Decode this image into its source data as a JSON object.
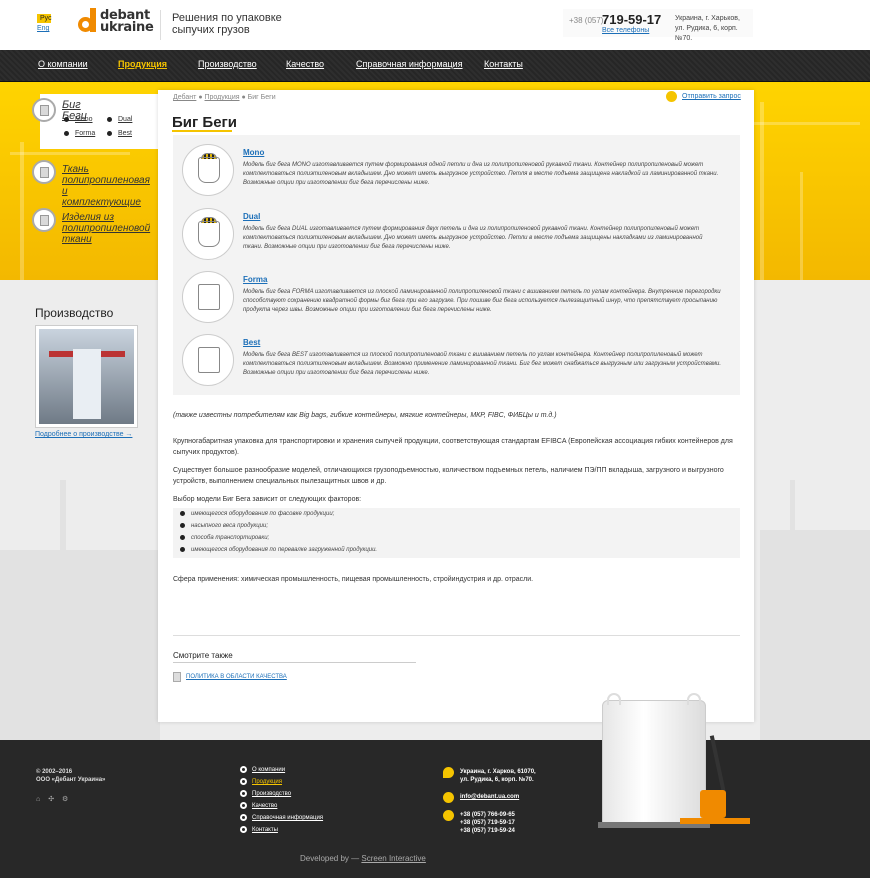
{
  "header": {
    "lang_ru": "Рус",
    "lang_en": "Eng",
    "logo_line1": "debant",
    "logo_line2": "ukraine",
    "tagline": "Решения по упаковке сыпучих грузов",
    "phone_code": "+38 (057)",
    "phone_number": "719-59-17",
    "all_phones": "Все телефоны",
    "address_line1": "Украина, г. Харьков,",
    "address_line2": "ул. Рудика, 6, корп. №70."
  },
  "nav": [
    "О компании",
    "Продукция",
    "Производство",
    "Качество",
    "Справочная информация",
    "Контакты"
  ],
  "sidebar": {
    "categories": [
      {
        "title": "Биг Беги"
      },
      {
        "title": "Ткань полипропиленовая и комплектующие"
      },
      {
        "title": "Изделия из полипропиленовой ткани"
      }
    ],
    "subitems": [
      "Mono",
      "Dual",
      "Forma",
      "Best"
    ],
    "production_title": "Производство",
    "production_link": "Подробнее о производстве →"
  },
  "breadcrumb": [
    "Дебант",
    "Продукция",
    "Биг Беги"
  ],
  "send_request": "Отправить запрос",
  "page_title": "Биг Беги",
  "types": [
    {
      "name": "Mono",
      "desc": "Модель биг бега MONO изготавливается путем формирования одной петли и дна из полипропиленовой рукавной ткани. Контейнер полипропиленовый может комплектоваться полиэтиленовым вкладышем. Дно может иметь выгрузное устройство. Петля в месте подъема защищена накладкой из ламинированной ткани. Возможные опции при изготовлении биг бега перечислены ниже."
    },
    {
      "name": "Dual",
      "desc": "Модель биг бега DUAL изготавливается путем формирования двух петель и дна из полипропиленовой рукавной ткани. Контейнер полипропиленовый может комплектоваться полиэтиленовым вкладышем. Дно может иметь выгрузное устройство. Петли в месте подъема защищены накладками из ламинированной ткани. Возможные опции при изготовлении биг бега перечислены ниже."
    },
    {
      "name": "Forma",
      "desc": "Модель биг бега FORMA изготавливается из плоской ламинированной полипропиленовой ткани с вшиванием петель по углам контейнера. Внутренние перегородки способствуют сохранению квадратной формы биг бега при его загрузке. При пошиве биг бега используется пылезащитный шнур, что препятствует просыпанию продукта через швы. Возможные опции при изготовлении биг бега перечислены ниже."
    },
    {
      "name": "Best",
      "desc": "Модель биг бега BEST изготавливается из плоской полипропиленовой ткани с вшиванием петель по углам контейнера. Контейнер полипропиленовый может комплектоваться полиэтиленовым вкладышем. Возможно применение ламинированной ткани. Биг бег может снабжаться выгрузным или загрузным устройствами. Возможные опции при изготовлении биг бега перечислены ниже."
    }
  ],
  "also_known": "(также известны потребителям как Big bags, гибкие контейнеры, мягкие контейнеры, МКР, FIBC, ФИБЦы и т.д.)",
  "para1": "Крупногабаритная упаковка для транспортировки и хранения сыпучей продукции, соответствующая стандартам EFIBCA (Европейская ассоциация гибких контейнеров для сыпучих продуктов).",
  "para2": "Существует большое разнообразие моделей, отличающихся грузоподъемностью, количеством подъемных петель, наличием ПЭ/ПП вкладыша, загрузного и выгрузного устройств, выполнением специальных пылезащитных швов и др.",
  "factors_title": "Выбор модели Биг Бега зависит от следующих факторов:",
  "factors": [
    "имеющегося оборудования по фасовке продукции;",
    "насыпного веса продукции;",
    "способа транспортировки;",
    "имеющегося оборудования по перевалке загруженной продукции."
  ],
  "application": "Сфера применения: химическая промышленность, пищевая промышленность, стройиндустрия и др. отрасли.",
  "see_also": "Смотрите также",
  "see_also_link": "ПОЛИТИКА В ОБЛАСТИ КАЧЕСТВА",
  "footer": {
    "copyright1": "© 2002–2016",
    "copyright2": "ООО «Дебант Украина»",
    "social": [
      "⌂",
      "✣",
      "⚙"
    ],
    "menu": [
      "О компании",
      "Продукция",
      "Производство",
      "Качество",
      "Справочная информация",
      "Контакты"
    ],
    "address1": "Украина, г. Харков, 61070,",
    "address2": "ул. Рудика, 6, корп. №70.",
    "email": "info@debant.ua.com",
    "phone1": "+38 (057) 766-09-65",
    "phone2": "+38 (057) 719-59-17",
    "phone3": "+38 (057) 719-59-24",
    "developed_by": "Developed by —",
    "developer": "Screen Interactive"
  },
  "colors": {
    "accent": "#f5c400",
    "orange": "#f08a00",
    "link": "#1c6fb8",
    "dark": "#282828"
  }
}
